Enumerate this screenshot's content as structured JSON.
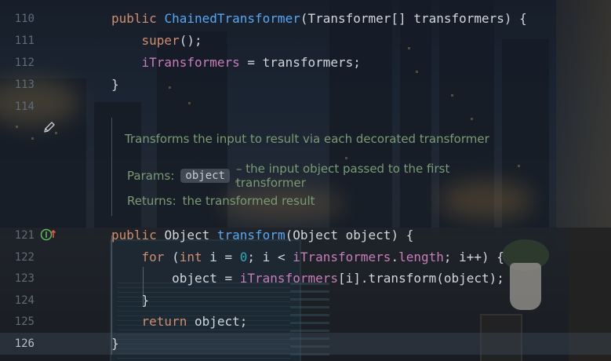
{
  "editor": {
    "lines": [
      {
        "number": "110",
        "tokens": [
          [
            "kw",
            "public "
          ],
          [
            "fn",
            "ChainedTransformer"
          ],
          [
            "",
            "(Transformer[] transformers) {"
          ]
        ]
      },
      {
        "number": "111",
        "tokens": [
          [
            "",
            "    "
          ],
          [
            "kw",
            "super"
          ],
          [
            "",
            "();"
          ]
        ]
      },
      {
        "number": "112",
        "tokens": [
          [
            "",
            "    "
          ],
          [
            "fld",
            "iTransformers"
          ],
          [
            "",
            " = transformers;"
          ]
        ]
      },
      {
        "number": "113",
        "tokens": [
          [
            "",
            "}"
          ]
        ]
      },
      {
        "number": "114",
        "tokens": []
      },
      {
        "number": "121",
        "tokens": [
          [
            "kw",
            "public "
          ],
          [
            "",
            "Object "
          ],
          [
            "fn",
            "transform"
          ],
          [
            "",
            "(Object object) {"
          ]
        ]
      },
      {
        "number": "122",
        "tokens": [
          [
            "",
            "    "
          ],
          [
            "kw",
            "for "
          ],
          [
            "",
            "("
          ],
          [
            "kw",
            "int "
          ],
          [
            "",
            "i = "
          ],
          [
            "num",
            "0"
          ],
          [
            "",
            "; i < "
          ],
          [
            "fld",
            "iTransformers"
          ],
          [
            "",
            "."
          ],
          [
            "fld",
            "length"
          ],
          [
            "",
            "; i++) {"
          ]
        ]
      },
      {
        "number": "123",
        "tokens": [
          [
            "",
            "        object = "
          ],
          [
            "fld",
            "iTransformers"
          ],
          [
            "",
            "[i].transform(object);"
          ]
        ]
      },
      {
        "number": "124",
        "tokens": [
          [
            "",
            "    }"
          ]
        ]
      },
      {
        "number": "125",
        "tokens": [
          [
            "",
            "    "
          ],
          [
            "kw",
            "return "
          ],
          [
            "",
            "object;"
          ]
        ]
      },
      {
        "number": "126",
        "tokens": [
          [
            "",
            "}"
          ]
        ]
      }
    ],
    "active_line": "126"
  },
  "doc": {
    "summary": "Transforms the input to result via each decorated transformer",
    "params_label": "Params:",
    "param_name": "object",
    "param_desc": "– the input object passed to the first transformer",
    "returns_label": "Returns:",
    "returns_desc": "the transformed result"
  },
  "icons": {
    "edit_doc": "pencil-icon",
    "implements": "implements-method-icon"
  },
  "colors": {
    "keyword": "#cf8e6d",
    "function": "#56a8f5",
    "field": "#c77dbb",
    "number": "#2aacb8",
    "doc_text": "#7a9a74"
  }
}
